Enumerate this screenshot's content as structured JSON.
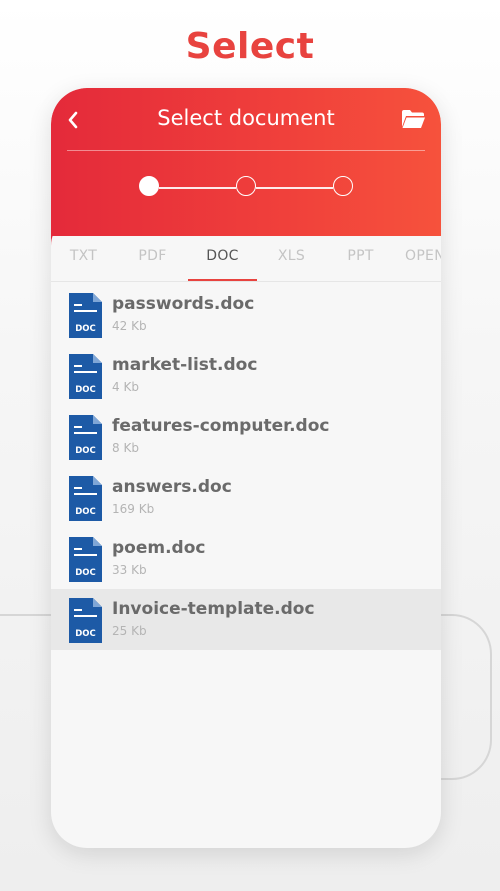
{
  "promo": {
    "title": "Select"
  },
  "header": {
    "title": "Select document",
    "back_icon": "chevron-left-icon",
    "folder_icon": "folder-open-icon",
    "steps": [
      {
        "state": "active"
      },
      {
        "state": "inactive"
      },
      {
        "state": "inactive"
      }
    ]
  },
  "tabs": [
    {
      "label": "TXT"
    },
    {
      "label": "PDF"
    },
    {
      "label": "DOC"
    },
    {
      "label": "XLS"
    },
    {
      "label": "PPT"
    },
    {
      "label": "OPEN"
    }
  ],
  "active_tab": "DOC",
  "file_icon_label": "DOC",
  "files": [
    {
      "name": "passwords.doc",
      "size": "42 Kb"
    },
    {
      "name": "market-list.doc",
      "size": "4 Kb"
    },
    {
      "name": "features-computer.doc",
      "size": "8 Kb"
    },
    {
      "name": "answers.doc",
      "size": "169 Kb"
    },
    {
      "name": "poem.doc",
      "size": "33 Kb"
    },
    {
      "name": "Invoice-template.doc",
      "size": "25 Kb"
    }
  ],
  "highlighted_file": "Invoice-template.doc",
  "colors": {
    "accent": "#e8433f",
    "header_start": "#e42a3a",
    "header_end": "#f6523c",
    "doc_icon": "#1d5aa6"
  }
}
